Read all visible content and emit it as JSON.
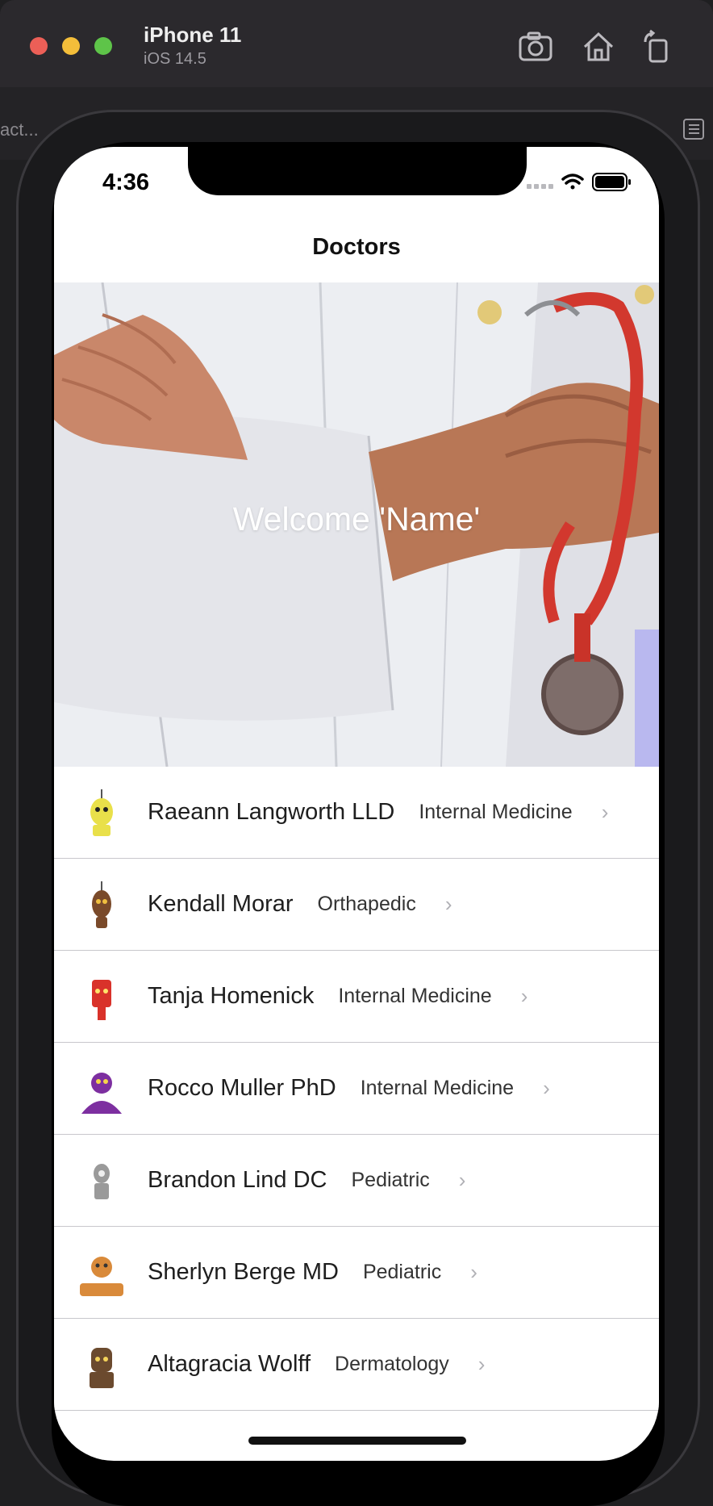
{
  "simulator": {
    "device_name": "iPhone 11",
    "os_version": "iOS 14.5",
    "background_text": "act..."
  },
  "status_bar": {
    "time": "4:36"
  },
  "nav": {
    "title": "Doctors"
  },
  "hero": {
    "welcome_text": "Welcome 'Name'"
  },
  "doctors": [
    {
      "name": "Raeann Langworth LLD",
      "specialty": "Internal Medicine",
      "avatar_color": "#e9e04a"
    },
    {
      "name": "Kendall Morar",
      "specialty": "Orthapedic",
      "avatar_color": "#7a4a2a"
    },
    {
      "name": "Tanja Homenick",
      "specialty": "Internal Medicine",
      "avatar_color": "#d9322a"
    },
    {
      "name": "Rocco Muller PhD",
      "specialty": "Internal Medicine",
      "avatar_color": "#7d2fa0"
    },
    {
      "name": "Brandon Lind DC",
      "specialty": "Pediatric",
      "avatar_color": "#9a9a9a"
    },
    {
      "name": "Sherlyn Berge MD",
      "specialty": "Pediatric",
      "avatar_color": "#d98a3a"
    },
    {
      "name": "Altagracia Wolff",
      "specialty": "Dermatology",
      "avatar_color": "#6b4a2e"
    }
  ],
  "chevron_glyph": "›"
}
